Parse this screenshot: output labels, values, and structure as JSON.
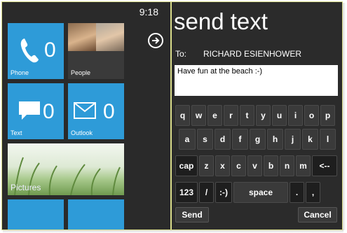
{
  "status": {
    "time": "9:18"
  },
  "start_screen": {
    "tiles": {
      "phone": {
        "label": "Phone",
        "count": "0",
        "icon": "phone-icon"
      },
      "people": {
        "label": "People"
      },
      "text": {
        "label": "Text",
        "count": "0",
        "icon": "message-icon"
      },
      "outlook": {
        "label": "Outlook",
        "count": "0",
        "icon": "mail-icon"
      },
      "pictures": {
        "label": "Pictures"
      }
    },
    "accent_color": "#2e9bd8"
  },
  "compose": {
    "title": "send text",
    "to_label": "To:",
    "recipient": "RICHARD ESIENHOWER",
    "message": "Have fun at the beach  :-)"
  },
  "keyboard": {
    "row1": [
      "q",
      "w",
      "e",
      "r",
      "t",
      "y",
      "u",
      "i",
      "o",
      "p"
    ],
    "row2": [
      "a",
      "s",
      "d",
      "f",
      "g",
      "h",
      "j",
      "k",
      "l"
    ],
    "row3": [
      "cap",
      "z",
      "x",
      "c",
      "v",
      "b",
      "n",
      "m",
      "<--"
    ],
    "row4": [
      "123",
      "/",
      ":-)",
      "space",
      ".",
      ","
    ]
  },
  "actions": {
    "send": "Send",
    "cancel": "Cancel"
  }
}
